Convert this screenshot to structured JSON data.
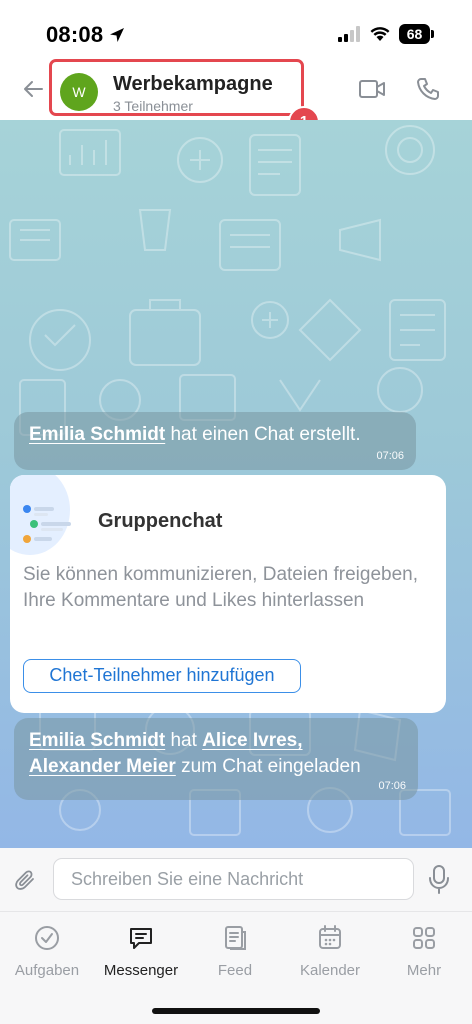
{
  "status_bar": {
    "time": "08:08",
    "battery": "68"
  },
  "header": {
    "avatar_initial": "W",
    "title": "Werbekampagne",
    "subtitle": "3 Teilnehmer",
    "badge": "1",
    "accent_color": "#e4474f",
    "avatar_color": "#5fa51d"
  },
  "messages": [
    {
      "type": "system",
      "actor": "Emilia Schmidt",
      "text": "hat einen Chat erstellt.",
      "time": "07:06"
    },
    {
      "type": "info_card",
      "title": "Gruppenchat",
      "description": "Sie können kommunizieren, Dateien freigeben, Ihre Kommentare und Likes hinterlassen",
      "button_label": "Chet-Teilnehmer hinzufügen"
    },
    {
      "type": "system",
      "actor": "Emilia Schmidt",
      "text_1": "hat",
      "user_1": "Alice Ivres,",
      "user_2": "Alexander Meier",
      "text_2": "zum Chat eingeladen",
      "time": "07:06"
    }
  ],
  "input": {
    "placeholder": "Schreiben Sie eine Nachricht"
  },
  "nav": [
    {
      "label": "Aufgaben",
      "icon": "check-circle-icon"
    },
    {
      "label": "Messenger",
      "icon": "chat-bubble-icon",
      "active": true
    },
    {
      "label": "Feed",
      "icon": "feed-icon"
    },
    {
      "label": "Kalender",
      "icon": "calendar-icon"
    },
    {
      "label": "Mehr",
      "icon": "grid-icon"
    }
  ]
}
